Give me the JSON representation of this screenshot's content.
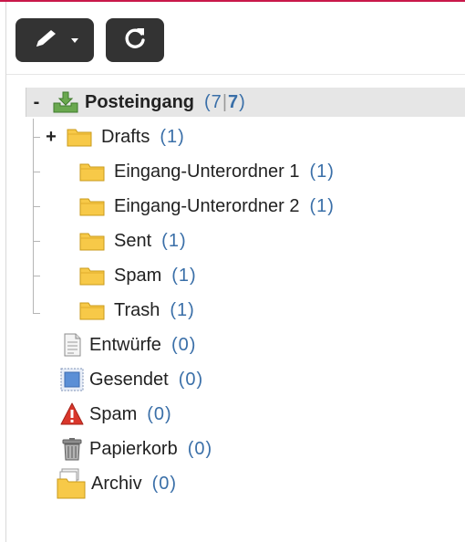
{
  "toolbar": {
    "edit_icon": "pencil-icon",
    "dropdown_icon": "caret-down-icon",
    "refresh_icon": "refresh-icon"
  },
  "inbox": {
    "toggle": "-",
    "icon": "inbox-download-icon",
    "label": "Posteingang",
    "count_open": "(7",
    "count_sep": "|",
    "count_unread": "7",
    "count_close": ")"
  },
  "subfolders": [
    {
      "toggle": "+",
      "label": "Drafts",
      "count": "(1)",
      "icon": "folder-icon"
    },
    {
      "toggle": "",
      "label": "Eingang-Unterordner 1",
      "count": "(1)",
      "icon": "folder-icon"
    },
    {
      "toggle": "",
      "label": "Eingang-Unterordner 2",
      "count": "(1)",
      "icon": "folder-icon"
    },
    {
      "toggle": "",
      "label": "Sent",
      "count": "(1)",
      "icon": "folder-icon"
    },
    {
      "toggle": "",
      "label": "Spam",
      "count": "(1)",
      "icon": "folder-icon"
    },
    {
      "toggle": "",
      "label": "Trash",
      "count": "(1)",
      "icon": "folder-icon"
    }
  ],
  "system_folders": [
    {
      "label": "Entwürfe",
      "count": "(0)",
      "icon": "drafts-document-icon"
    },
    {
      "label": "Gesendet",
      "count": "(0)",
      "icon": "sent-stamp-icon"
    },
    {
      "label": "Spam",
      "count": "(0)",
      "icon": "spam-warning-icon"
    },
    {
      "label": "Papierkorb",
      "count": "(0)",
      "icon": "trash-can-icon"
    },
    {
      "label": "Archiv",
      "count": "(0)",
      "icon": "archive-folder-icon"
    }
  ],
  "colors": {
    "toolbar_button": "#333333",
    "count_text": "#3a6fa8",
    "folder": "#f7c948",
    "selected_row": "#e6e6e6",
    "accent_line": "#c9184a"
  }
}
